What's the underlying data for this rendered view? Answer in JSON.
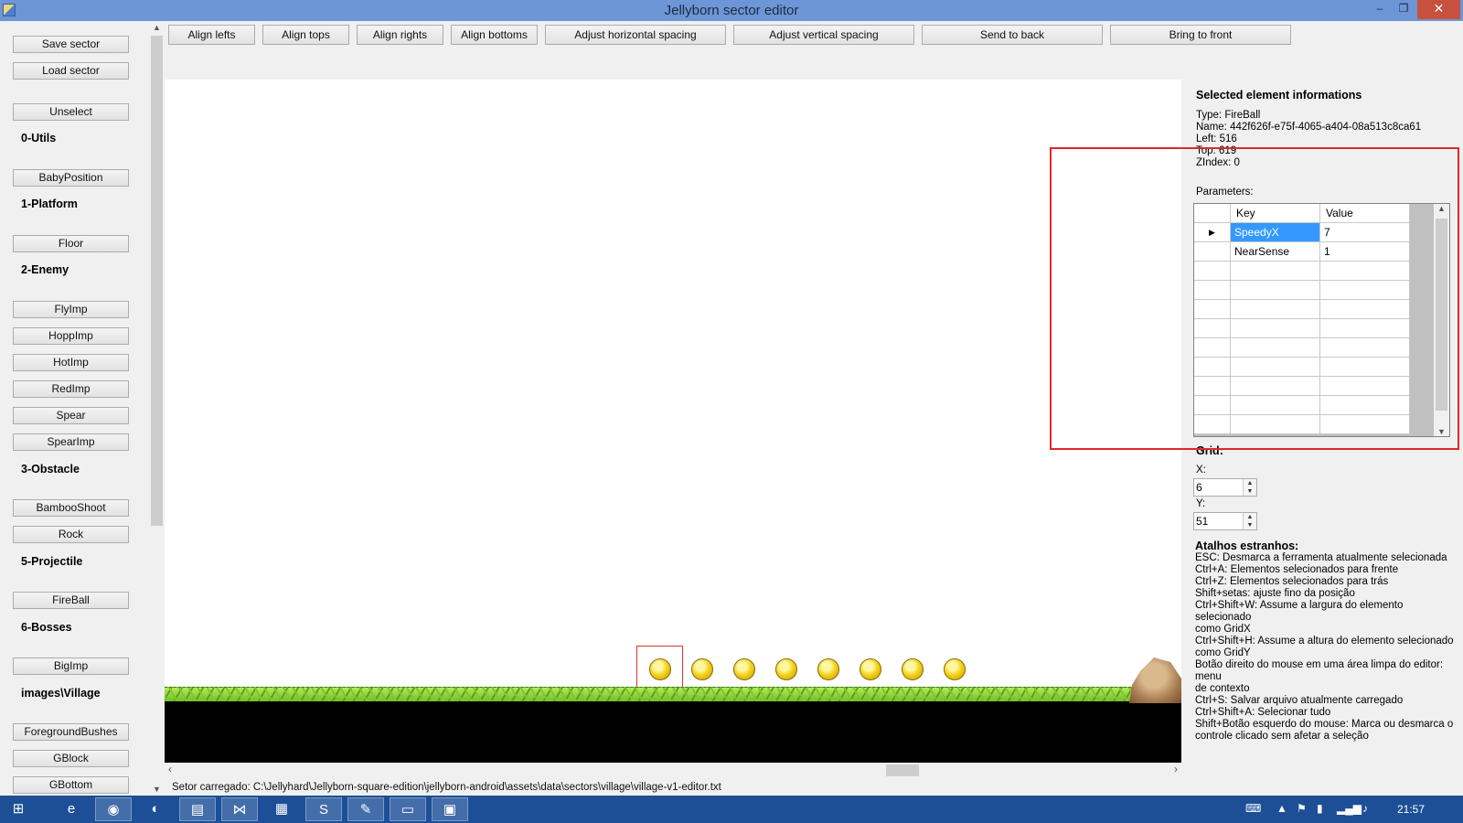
{
  "window": {
    "title": "Jellyborn sector editor",
    "minimize": "–",
    "restore": "❐",
    "close": "✕"
  },
  "left": {
    "buttons": [
      {
        "label": "Save sector"
      },
      {
        "label": "Load sector"
      },
      {
        "label": "Unselect"
      },
      {
        "label": "BabyPosition"
      },
      {
        "label": "Floor"
      },
      {
        "label": "FlyImp"
      },
      {
        "label": "HoppImp"
      },
      {
        "label": "HotImp"
      },
      {
        "label": "RedImp"
      },
      {
        "label": "Spear"
      },
      {
        "label": "SpearImp"
      },
      {
        "label": "BambooShoot"
      },
      {
        "label": "Rock"
      },
      {
        "label": "FireBall"
      },
      {
        "label": "BigImp"
      },
      {
        "label": "ForegroundBushes"
      },
      {
        "label": "GBlock"
      },
      {
        "label": "GBottom"
      }
    ],
    "categories": [
      {
        "label": "0-Utils"
      },
      {
        "label": "1-Platform"
      },
      {
        "label": "2-Enemy"
      },
      {
        "label": "3-Obstacle"
      },
      {
        "label": "5-Projectile"
      },
      {
        "label": "6-Bosses"
      },
      {
        "label": "images\\Village"
      }
    ]
  },
  "toolbar": {
    "buttons": [
      {
        "label": "Align lefts"
      },
      {
        "label": "Align tops"
      },
      {
        "label": "Align rights"
      },
      {
        "label": "Align bottoms"
      },
      {
        "label": "Adjust horizontal spacing"
      },
      {
        "label": "Adjust vertical spacing"
      },
      {
        "label": "Send to back"
      },
      {
        "label": "Bring to front"
      }
    ]
  },
  "info": {
    "header": "Selected element informations",
    "type": "Type: FireBall",
    "name": "Name: 442f626f-e75f-4065-a404-08a513c8ca61",
    "left": "Left: 516",
    "top": "Top: 619",
    "zindex": "ZIndex: 0",
    "params_label": "Parameters:"
  },
  "params": {
    "col_key": "Key",
    "col_value": "Value",
    "rows": [
      {
        "key": "SpeedyX",
        "value": "7"
      },
      {
        "key": "NearSense",
        "value": "1"
      }
    ]
  },
  "grid": {
    "label": "Grid:",
    "x_label": "X:",
    "x_value": "6",
    "y_label": "Y:",
    "y_value": "51"
  },
  "shortcuts": {
    "title": "Atalhos estranhos:",
    "lines": [
      "ESC: Desmarca a ferramenta atualmente selecionada",
      "Ctrl+A: Elementos selecionados para frente",
      "Ctrl+Z: Elementos selecionados para trás",
      "Shift+setas: ajuste fino da posição",
      "Ctrl+Shift+W: Assume a largura do elemento selecionado",
      "como GridX",
      "Ctrl+Shift+H: Assume a altura do elemento selecionado",
      "como GridY",
      "Botão direito do mouse em uma área limpa do editor: menu",
      "de contexto",
      "Ctrl+S: Salvar arquivo atualmente carregado",
      "Ctrl+Shift+A: Selecionar tudo",
      "Shift+Botão esquerdo do mouse: Marca ou desmarca o",
      "controle clicado sem afetar a seleção"
    ]
  },
  "status": "Setor carregado: C:\\Jellyhard\\Jellyborn-square-edition\\jellyborn-android\\assets\\data\\sectors\\village\\village-v1-editor.txt",
  "taskbar": {
    "clock": "21:57"
  },
  "icons": {
    "start": "windows-start-icon",
    "ie": "internet-explorer-icon",
    "chrome": "chrome-icon",
    "firefox": "firefox-icon",
    "explorer": "file-explorer-icon",
    "vs": "visual-studio-icon",
    "excel": "excel-icon",
    "skype": "skype-icon",
    "editor": "notepad-icon",
    "cmd": "command-prompt-icon",
    "app": "jellyborn-editor-icon"
  }
}
